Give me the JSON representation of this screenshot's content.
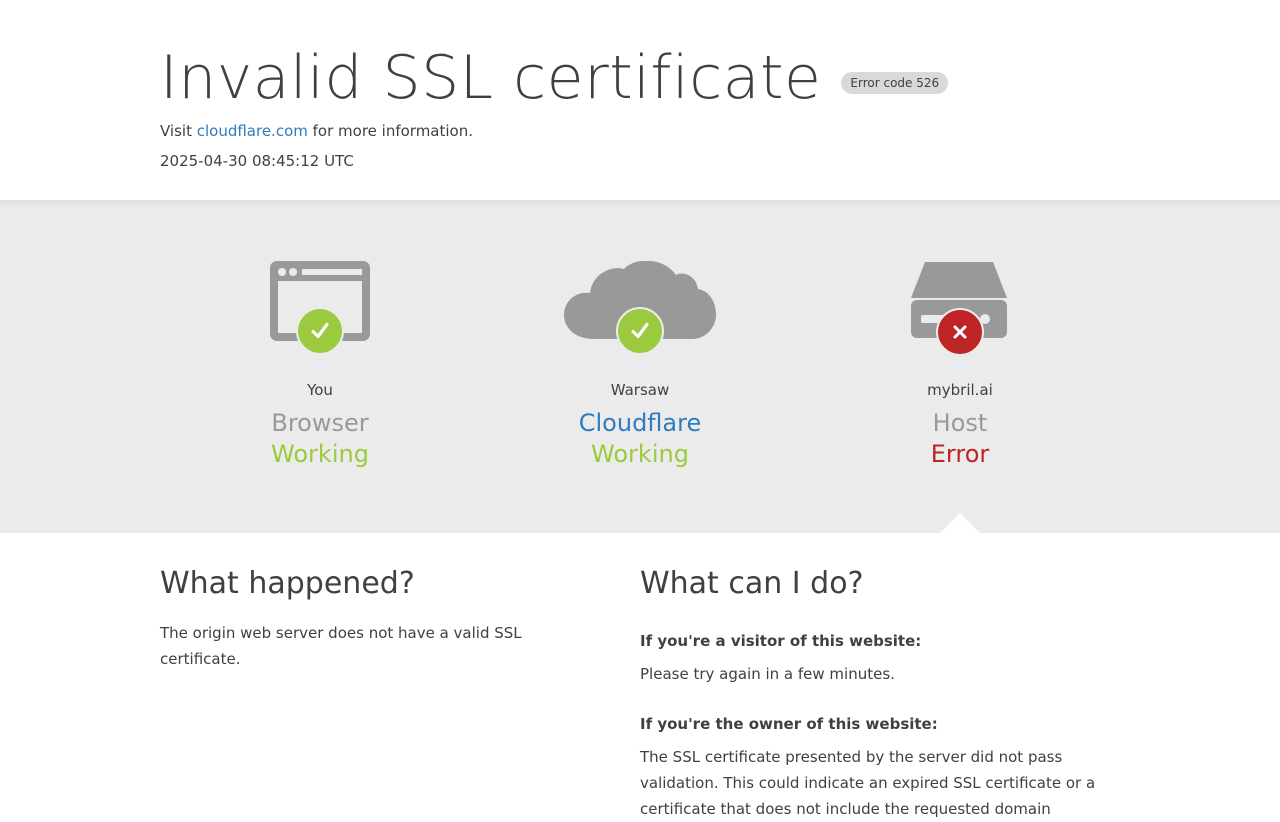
{
  "header": {
    "title": "Invalid SSL certificate",
    "error_code": "Error code 526",
    "visit_prefix": "Visit ",
    "visit_link": "cloudflare.com",
    "visit_suffix": " for more information.",
    "timestamp": "2025-04-30 08:45:12 UTC"
  },
  "status": {
    "browser": {
      "location": "You",
      "role": "Browser",
      "status": "Working",
      "icon": "browser-icon",
      "state_icon": "check-icon"
    },
    "cloudflare": {
      "location": "Warsaw",
      "role": "Cloudflare",
      "status": "Working",
      "icon": "cloud-icon",
      "state_icon": "check-icon"
    },
    "host": {
      "location": "mybril.ai",
      "role": "Host",
      "status": "Error",
      "icon": "server-icon",
      "state_icon": "x-icon"
    }
  },
  "colors": {
    "ok": "#9bca3e",
    "error": "#bd2426",
    "link": "#2f7bbf"
  },
  "details": {
    "what_happened_title": "What happened?",
    "what_happened_text": "The origin web server does not have a valid SSL certificate.",
    "what_can_i_do_title": "What can I do?",
    "visitor_heading": "If you're a visitor of this website:",
    "visitor_text": "Please try again in a few minutes.",
    "owner_heading": "If you're the owner of this website:",
    "owner_text": "The SSL certificate presented by the server did not pass validation. This could indicate an expired SSL certificate or a certificate that does not include the requested domain"
  }
}
